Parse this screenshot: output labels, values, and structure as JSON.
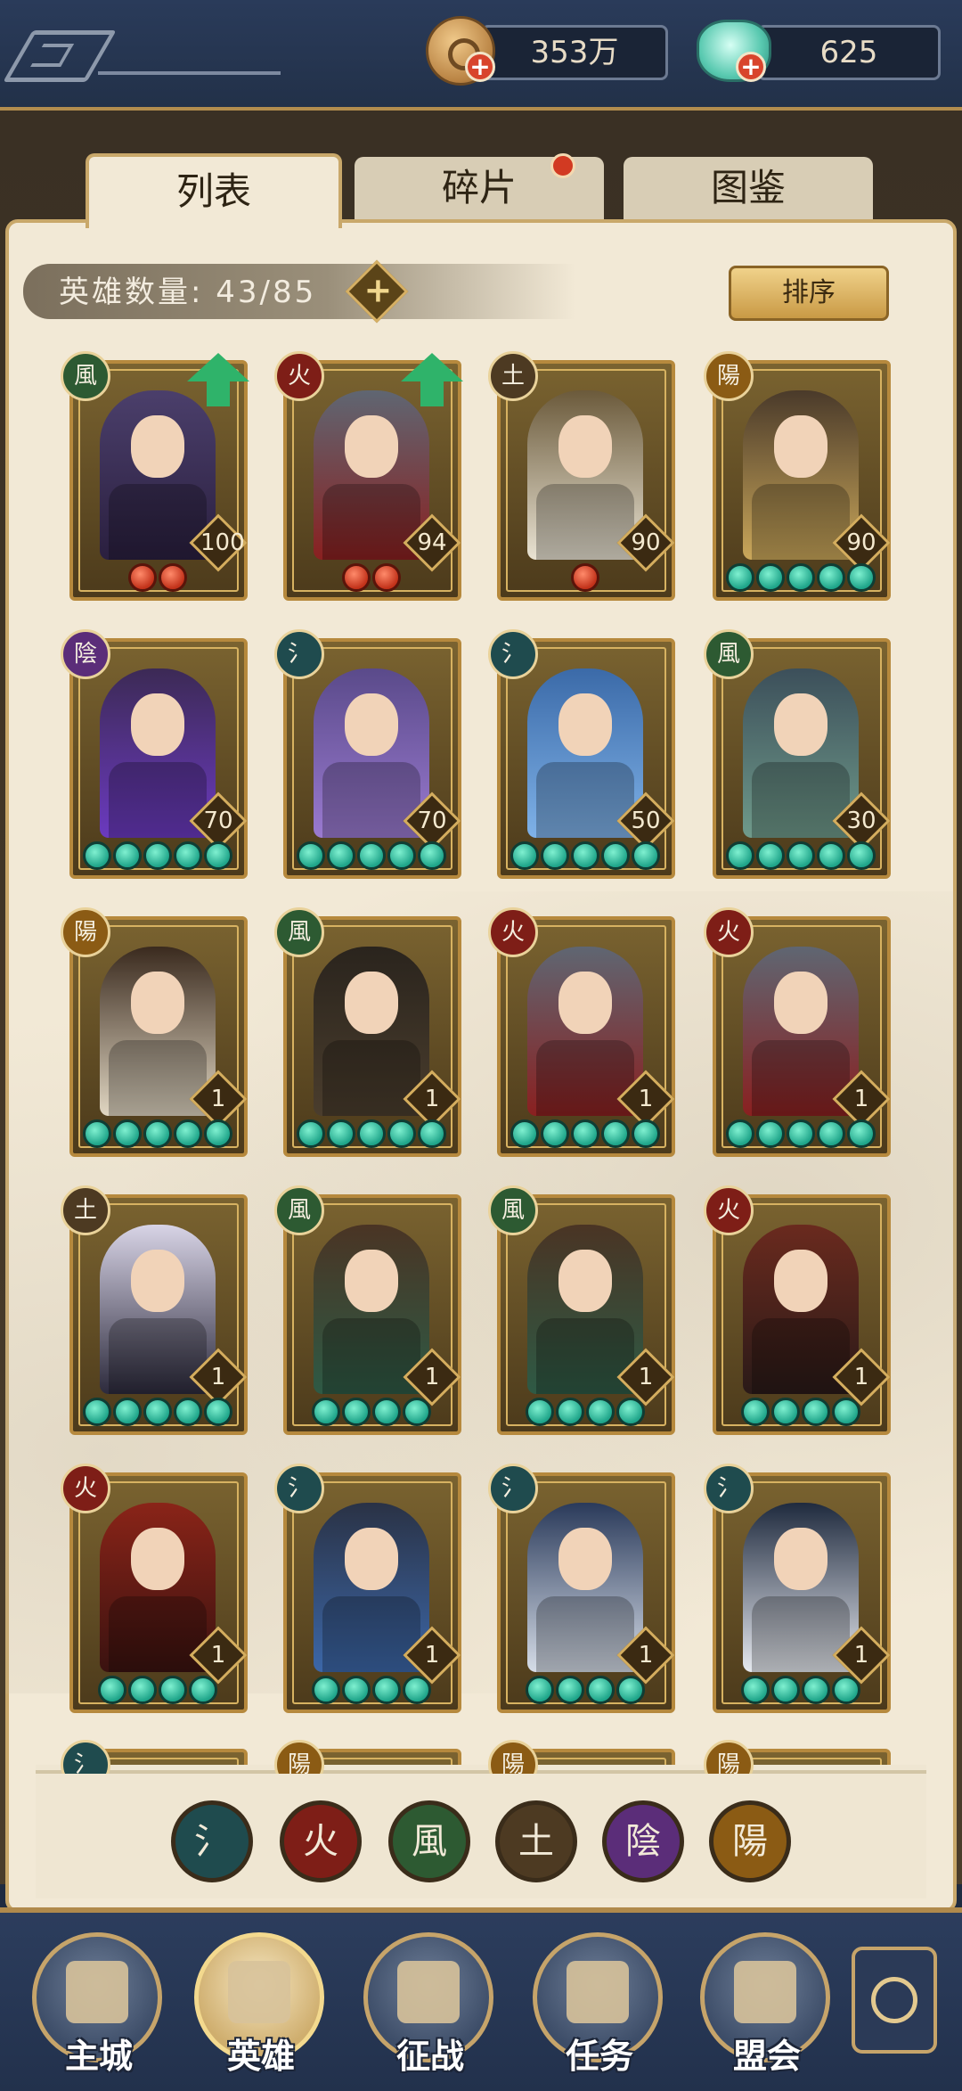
{
  "top": {
    "coins": "353万",
    "jade": "625",
    "plus": "+"
  },
  "tabs": [
    {
      "label": "列表",
      "active": true
    },
    {
      "label": "碎片",
      "active": false,
      "notify": true
    },
    {
      "label": "图鉴",
      "active": false
    }
  ],
  "hero_count": {
    "label": "英雄数量:",
    "value": "43/85",
    "plus": "+"
  },
  "sort_label": "排序",
  "elements": {
    "water": {
      "glyph": "氵",
      "color": "#1f4b4e"
    },
    "fire": {
      "glyph": "火",
      "color": "#7e1e17"
    },
    "wind": {
      "glyph": "風",
      "color": "#2d5a32"
    },
    "earth": {
      "glyph": "土",
      "color": "#4d3a22"
    },
    "yin": {
      "glyph": "陰",
      "color": "#5b2d79"
    },
    "yang": {
      "glyph": "陽",
      "color": "#8b5b14"
    }
  },
  "heroes": [
    {
      "element": "wind",
      "level": "100",
      "stars": 2,
      "star_color": "red",
      "upgrade": true,
      "palette": [
        "#4b3f6b",
        "#2a1f3f"
      ]
    },
    {
      "element": "fire",
      "level": "94",
      "stars": 2,
      "star_color": "red",
      "upgrade": true,
      "palette": [
        "#5f6672",
        "#8a2020"
      ]
    },
    {
      "element": "earth",
      "level": "90",
      "stars": 1,
      "star_color": "red",
      "upgrade": false,
      "palette": [
        "#6b5a3b",
        "#e9e3d3"
      ]
    },
    {
      "element": "yang",
      "level": "90",
      "stars": 5,
      "star_color": "teal",
      "upgrade": false,
      "palette": [
        "#4a3a2a",
        "#caa75a"
      ]
    },
    {
      "element": "yin",
      "level": "70",
      "stars": 5,
      "star_color": "teal",
      "upgrade": false,
      "palette": [
        "#3c2a55",
        "#6b3ac0"
      ]
    },
    {
      "element": "water",
      "level": "70",
      "stars": 5,
      "star_color": "teal",
      "upgrade": false,
      "palette": [
        "#5a4a8a",
        "#9a7ad0"
      ]
    },
    {
      "element": "water",
      "level": "50",
      "stars": 5,
      "star_color": "teal",
      "upgrade": false,
      "palette": [
        "#3b6aa8",
        "#7fb2e8"
      ]
    },
    {
      "element": "wind",
      "level": "30",
      "stars": 5,
      "star_color": "teal",
      "upgrade": false,
      "palette": [
        "#3c4f5a",
        "#6f9a8a"
      ]
    },
    {
      "element": "yang",
      "level": "1",
      "stars": 5,
      "star_color": "teal",
      "upgrade": false,
      "palette": [
        "#3a2a1e",
        "#e0d6c2"
      ]
    },
    {
      "element": "wind",
      "level": "1",
      "stars": 5,
      "star_color": "teal",
      "upgrade": false,
      "palette": [
        "#2a241d",
        "#4a3d2d"
      ]
    },
    {
      "element": "fire",
      "level": "1",
      "stars": 5,
      "star_color": "teal",
      "upgrade": false,
      "palette": [
        "#5f6672",
        "#8a2020"
      ]
    },
    {
      "element": "fire",
      "level": "1",
      "stars": 5,
      "star_color": "teal",
      "upgrade": false,
      "palette": [
        "#5f6672",
        "#8a2020"
      ]
    },
    {
      "element": "earth",
      "level": "1",
      "stars": 5,
      "star_color": "teal",
      "upgrade": false,
      "palette": [
        "#d8d4e6",
        "#2c2a3c"
      ]
    },
    {
      "element": "wind",
      "level": "1",
      "stars": 4,
      "star_color": "teal",
      "upgrade": false,
      "palette": [
        "#4a3424",
        "#2e5a45"
      ]
    },
    {
      "element": "wind",
      "level": "1",
      "stars": 4,
      "star_color": "teal",
      "upgrade": false,
      "palette": [
        "#4a3424",
        "#2e5a45"
      ]
    },
    {
      "element": "fire",
      "level": "1",
      "stars": 4,
      "star_color": "teal",
      "upgrade": false,
      "palette": [
        "#6a2a1e",
        "#2a1a18"
      ]
    },
    {
      "element": "fire",
      "level": "1",
      "stars": 4,
      "star_color": "teal",
      "upgrade": false,
      "palette": [
        "#8a2418",
        "#3a1210"
      ]
    },
    {
      "element": "water",
      "level": "1",
      "stars": 4,
      "star_color": "teal",
      "upgrade": false,
      "palette": [
        "#2a3245",
        "#3c67a8"
      ]
    },
    {
      "element": "water",
      "level": "1",
      "stars": 4,
      "star_color": "teal",
      "upgrade": false,
      "palette": [
        "#2a3a5a",
        "#d6dde8"
      ]
    },
    {
      "element": "water",
      "level": "1",
      "stars": 4,
      "star_color": "teal",
      "upgrade": false,
      "palette": [
        "#1f2a3e",
        "#e6e9ef"
      ]
    },
    {
      "element": "water",
      "level": "",
      "stars": 0,
      "star_color": "teal",
      "upgrade": false,
      "palette": [
        "#3a4a5a",
        "#5a6a7a"
      ]
    },
    {
      "element": "yang",
      "level": "",
      "stars": 0,
      "star_color": "teal",
      "upgrade": false,
      "palette": [
        "#4a3a2a",
        "#6a5a3a"
      ]
    },
    {
      "element": "yang",
      "level": "",
      "stars": 0,
      "star_color": "teal",
      "upgrade": false,
      "palette": [
        "#4a3a2a",
        "#6a5a3a"
      ]
    },
    {
      "element": "yang",
      "level": "",
      "stars": 0,
      "star_color": "teal",
      "upgrade": false,
      "palette": [
        "#4a3a2a",
        "#6a5a3a"
      ]
    }
  ],
  "filters": [
    "water",
    "fire",
    "wind",
    "earth",
    "yin",
    "yang"
  ],
  "nav": [
    {
      "label": "主城",
      "active": false
    },
    {
      "label": "英雄",
      "active": true
    },
    {
      "label": "征战",
      "active": false
    },
    {
      "label": "任务",
      "active": false
    },
    {
      "label": "盟会",
      "active": false
    }
  ]
}
